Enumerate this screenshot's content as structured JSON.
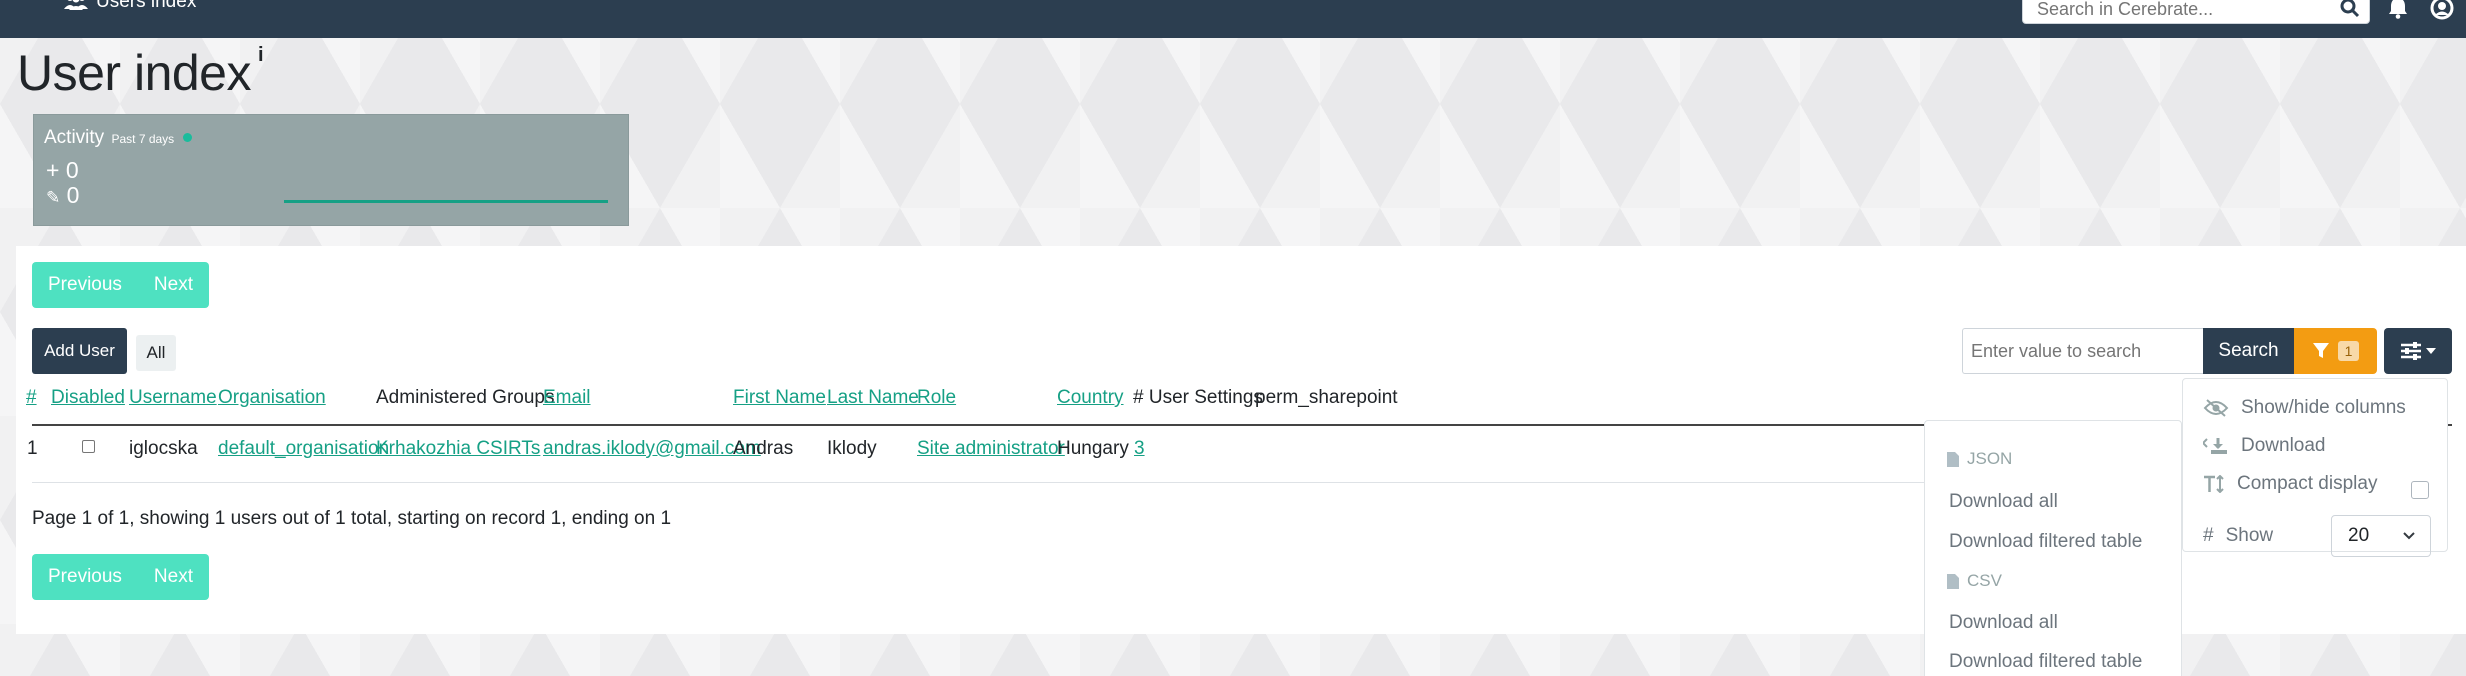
{
  "topbar": {
    "breadcrumb": "Users index",
    "search_placeholder": "Search in Cerebrate..."
  },
  "page": {
    "title": "User index",
    "info_glyph": "i"
  },
  "activity": {
    "label": "Activity",
    "period": "Past 7 days",
    "added_count": "0",
    "edited_count": "0"
  },
  "pagination": {
    "previous": "Previous",
    "next": "Next"
  },
  "toolbar": {
    "add_user": "Add User",
    "all": "All",
    "search_placeholder": "Enter value to search",
    "search_button": "Search",
    "filter_count": "1"
  },
  "table": {
    "headers": [
      "#",
      "Disabled",
      "Username",
      "Organisation",
      "Administered Groups",
      "Email",
      "First Name",
      "Last Name",
      "Role",
      "Country",
      "# User Settings",
      "perm_sharepoint"
    ],
    "rows": [
      {
        "id": "1",
        "disabled": false,
        "username": "iglocska",
        "organisation": "default_organisation",
        "administered_groups": "Krhakozhia CSIRTs",
        "email": "andras.iklody@gmail.com",
        "first_name": "Andras",
        "last_name": "Iklody",
        "role": "Site administrator",
        "country": "Hungary",
        "user_settings": "3"
      }
    ],
    "summary": "Page 1 of 1, showing 1 users out of 1 total, starting on record 1, ending on 1"
  },
  "download_menu": {
    "json_header": "JSON",
    "json_all": "Download all",
    "json_filtered": "Download filtered table",
    "csv_header": "CSV",
    "csv_all": "Download all",
    "csv_filtered": "Download filtered table"
  },
  "options_menu": {
    "show_hide_columns": "Show/hide columns",
    "download": "Download",
    "compact_display": "Compact display",
    "show_label": "Show",
    "show_value": "20"
  },
  "colors": {
    "navbar": "#2c3e50",
    "accent": "#16a085",
    "pager": "#4ee1c1",
    "filter": "#f39c12",
    "activity_bg": "#95a5a6"
  }
}
